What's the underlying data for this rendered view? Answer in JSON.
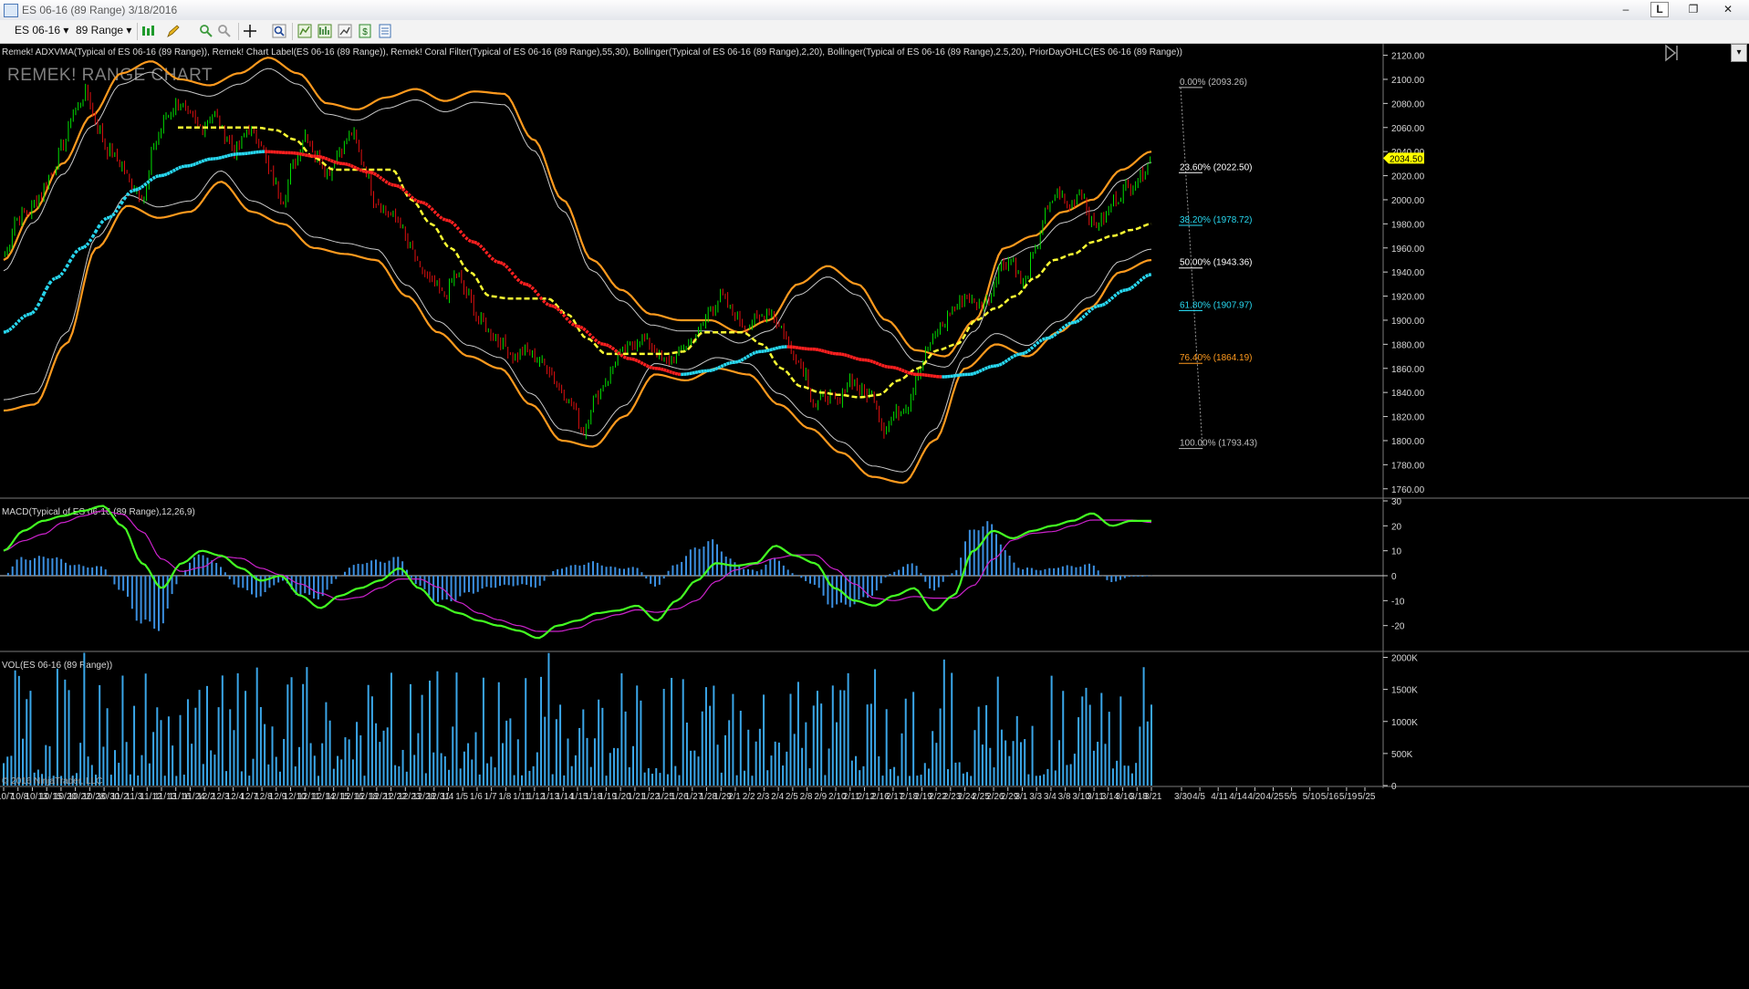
{
  "window": {
    "title": "ES 06-16 (89 Range)  3/18/2016",
    "lock_label": "L",
    "minimize_label": "–",
    "restore_label": "❐",
    "close_label": "✕"
  },
  "toolbar": {
    "instrument": "ES 06-16",
    "interval": "89 Range",
    "dropdown_glyph": "▾"
  },
  "colors": {
    "background": "#000000",
    "up_bar": "#00e000",
    "down_bar": "#e01010",
    "bollinger_outer": "#ff9a1e",
    "bollinger_inner": "#c9c9c9",
    "adxvma": "#ffff33",
    "coral": "#28d8f0",
    "coral_down": "#ff2020",
    "macd_line": "#44ff22",
    "macd_avg": "#cc22cc",
    "macd_hist": "#3b8fe0",
    "volume": "#3aa6e8",
    "price_marker": "#ffff00"
  },
  "chart_data": [
    {
      "type": "candlestick",
      "name": "price",
      "indicator_legend": "Remek! ADXVMA(Typical of ES 06-16 (89 Range)), Remek! Chart Label(ES 06-16 (89 Range)), Remek! Coral Filter(Typical of ES 06-16 (89 Range),55,30), Bollinger(Typical of ES 06-16 (89 Range),2,20), Bollinger(Typical of ES 06-16 (89 Range),2.5,20), PriorDayOHLC(ES 06-16 (89 Range))",
      "watermark": "REMEK! RANGE CHART",
      "ylim": [
        1753,
        2128
      ],
      "yticks": [
        1760,
        1780,
        1800,
        1820,
        1840,
        1860,
        1880,
        1900,
        1920,
        1940,
        1960,
        1980,
        2000,
        2020,
        2040,
        2060,
        2080,
        2100,
        2120
      ],
      "ytick_labels": [
        "1760.00",
        "1780.00",
        "1800.00",
        "1820.00",
        "1840.00",
        "1860.00",
        "1880.00",
        "1900.00",
        "1920.00",
        "1940.00",
        "1960.00",
        "1980.00",
        "2000.00",
        "2020.00",
        "2040.00",
        "2060.00",
        "2080.00",
        "2100.00",
        "2120.00"
      ],
      "last_price": 2034.5,
      "last_price_label": "2034.50",
      "close_path": [
        1955,
        1985,
        1990,
        2003,
        2022,
        2045,
        2075,
        2088,
        2062,
        2040,
        2030,
        2012,
        2003,
        2048,
        2070,
        2080,
        2068,
        2060,
        2072,
        2055,
        2040,
        2058,
        2050,
        2020,
        2000,
        2030,
        2055,
        2035,
        2024,
        2042,
        2055,
        2030,
        2000,
        1990,
        1983,
        1960,
        1940,
        1930,
        1920,
        1938,
        1920,
        1900,
        1890,
        1880,
        1870,
        1875,
        1868,
        1860,
        1845,
        1830,
        1808,
        1835,
        1850,
        1870,
        1878,
        1885,
        1878,
        1865,
        1870,
        1880,
        1890,
        1910,
        1920,
        1905,
        1895,
        1900,
        1908,
        1895,
        1875,
        1860,
        1830,
        1838,
        1830,
        1852,
        1840,
        1838,
        1810,
        1822,
        1830,
        1860,
        1880,
        1895,
        1910,
        1920,
        1912,
        1918,
        1945,
        1950,
        1930,
        1955,
        1990,
        2005,
        1995,
        2008,
        1980,
        1985,
        2000,
        2010,
        2018,
        2034.5
      ],
      "adxvma_path": [
        2060,
        2060,
        2060,
        2060,
        2060,
        2058,
        2050,
        2035,
        2025,
        2025,
        2025,
        2025,
        2000,
        1980,
        1960,
        1940,
        1920,
        1918,
        1918,
        1918,
        1905,
        1885,
        1872,
        1872,
        1872,
        1872,
        1874,
        1890,
        1890,
        1890,
        1880,
        1860,
        1845,
        1840,
        1838,
        1836,
        1838,
        1850,
        1860,
        1875,
        1880,
        1900,
        1910,
        1920,
        1935,
        1950,
        1955,
        1965,
        1970,
        1975,
        1980
      ],
      "coral_path": [
        1890,
        1905,
        1935,
        1960,
        1985,
        2008,
        2020,
        2028,
        2034,
        2038,
        2040,
        2039,
        2036,
        2030,
        2023,
        2012,
        1998,
        1983,
        1965,
        1948,
        1930,
        1912,
        1895,
        1880,
        1868,
        1860,
        1855,
        1858,
        1865,
        1874,
        1878,
        1876,
        1872,
        1867,
        1861,
        1855,
        1853,
        1855,
        1862,
        1872,
        1885,
        1898,
        1912,
        1925,
        1938
      ],
      "bollinger_upper_path": [
        1950,
        1990,
        2030,
        2070,
        2105,
        2115,
        2100,
        2095,
        2105,
        2118,
        2105,
        2080,
        2075,
        2085,
        2092,
        2082,
        2090,
        2088,
        2050,
        2000,
        1950,
        1925,
        1905,
        1900,
        1900,
        1890,
        1900,
        1930,
        1945,
        1930,
        1900,
        1875,
        1870,
        1900,
        1960,
        1970,
        1990,
        2000,
        2025,
        2040
      ],
      "bollinger_lower_path": [
        1825,
        1830,
        1880,
        1960,
        1995,
        1985,
        1990,
        2015,
        1990,
        1980,
        1960,
        1955,
        1950,
        1920,
        1890,
        1870,
        1860,
        1830,
        1800,
        1795,
        1820,
        1855,
        1850,
        1860,
        1855,
        1830,
        1810,
        1790,
        1770,
        1765,
        1800,
        1860,
        1880,
        1870,
        1890,
        1910,
        1940,
        1950
      ],
      "fibonacci": [
        {
          "level": "0.00%",
          "price": "(2093.26)"
        },
        {
          "level": "23.60%",
          "price": "(2022.50)"
        },
        {
          "level": "38.20%",
          "price": "(1978.72)"
        },
        {
          "level": "50.00%",
          "price": "(1943.36)"
        },
        {
          "level": "61.80%",
          "price": "(1907.97)"
        },
        {
          "level": "76.40%",
          "price": "(1864.19)"
        },
        {
          "level": "100.00%",
          "price": "(1793.43)"
        }
      ]
    },
    {
      "type": "line+bar",
      "name": "macd",
      "indicator_legend": "MACD(Typical of ES 06-16 (89 Range),12,26,9)",
      "ylim": [
        -30,
        30
      ],
      "yticks": [
        30,
        20,
        10,
        0,
        -10,
        -20
      ],
      "ytick_labels": [
        "30",
        "20",
        "10",
        "0",
        "-10",
        "-20"
      ],
      "macd_path": [
        10,
        18,
        22,
        24,
        26,
        28,
        20,
        5,
        -5,
        5,
        10,
        8,
        3,
        -2,
        0,
        -8,
        -13,
        -8,
        -5,
        -2,
        3,
        -5,
        -12,
        -15,
        -18,
        -20,
        -22,
        -25,
        -20,
        -18,
        -15,
        -14,
        -12,
        -18,
        -10,
        -2,
        5,
        4,
        5,
        12,
        8,
        5,
        -5,
        -10,
        -12,
        -8,
        -5,
        -14,
        -8,
        10,
        18,
        15,
        18,
        20,
        22,
        25,
        20,
        22,
        22
      ]
    },
    {
      "type": "bar",
      "name": "volume",
      "indicator_legend": "VOL(ES 06-16 (89 Range))",
      "ylim": [
        0,
        2050000
      ],
      "yticks": [
        0,
        500000,
        1000000,
        1500000,
        2000000
      ],
      "ytick_labels": [
        "0",
        "500K",
        "1000K",
        "1500K",
        "2000K"
      ],
      "copyright": "© 2016 NinjaTrader, LLC"
    }
  ],
  "x_axis": {
    "labels": [
      "10/7",
      "10/8",
      "10/13",
      "10/15",
      "10/20",
      "10/22",
      "10/28",
      "10/30",
      "11/2",
      "11/3",
      "11/12",
      "11/13",
      "11/16",
      "11/24",
      "12/2",
      "12/3",
      "12/4",
      "12/7",
      "12/8",
      "12/9",
      "12/10",
      "12/11",
      "12/14",
      "12/15",
      "12/16",
      "12/18",
      "12/21",
      "12/22",
      "12/23",
      "12/28",
      "12/31",
      "1/4",
      "1/5",
      "1/6",
      "1/7",
      "1/8",
      "1/11",
      "1/12",
      "1/13",
      "1/14",
      "1/15",
      "1/18",
      "1/19",
      "1/20",
      "1/21",
      "1/22",
      "1/25",
      "1/26",
      "1/27",
      "1/28",
      "1/29",
      "2/1",
      "2/2",
      "2/3",
      "2/4",
      "2/5",
      "2/8",
      "2/9",
      "2/10",
      "2/11",
      "2/12",
      "2/16",
      "2/17",
      "2/18",
      "2/19",
      "2/22",
      "2/23",
      "2/24",
      "2/25",
      "2/26",
      "2/29",
      "3/1",
      "3/3",
      "3/4",
      "3/8",
      "3/10",
      "3/11",
      "3/14",
      "3/16",
      "3/18",
      "3/21",
      "3/30",
      "4/5",
      "4/11",
      "4/14",
      "4/20",
      "4/25",
      "5/5",
      "5/10",
      "5/16",
      "5/19",
      "5/25"
    ]
  }
}
